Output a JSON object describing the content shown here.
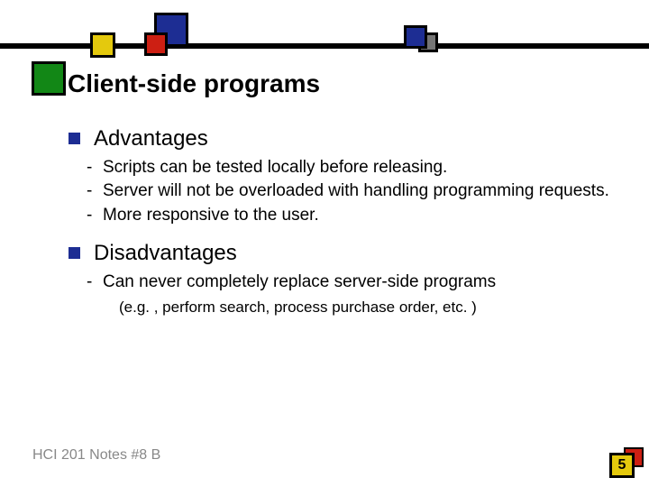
{
  "title": "Client-side programs",
  "sections": [
    {
      "heading": "Advantages",
      "items": [
        "Scripts can be tested locally before releasing.",
        "Server will not be overloaded with handling programming requests.",
        "More responsive to the user."
      ]
    },
    {
      "heading": "Disadvantages",
      "items": [
        "Can never completely replace server-side programs"
      ],
      "example": "(e.g. , perform search, process purchase order, etc. )"
    }
  ],
  "footer": "HCI 201 Notes #8 B",
  "page_number": "5",
  "colors": {
    "blue": "#1d2d93",
    "red": "#cd1f13",
    "yellow": "#e4c90d",
    "green": "#128716",
    "grey": "#757575"
  }
}
